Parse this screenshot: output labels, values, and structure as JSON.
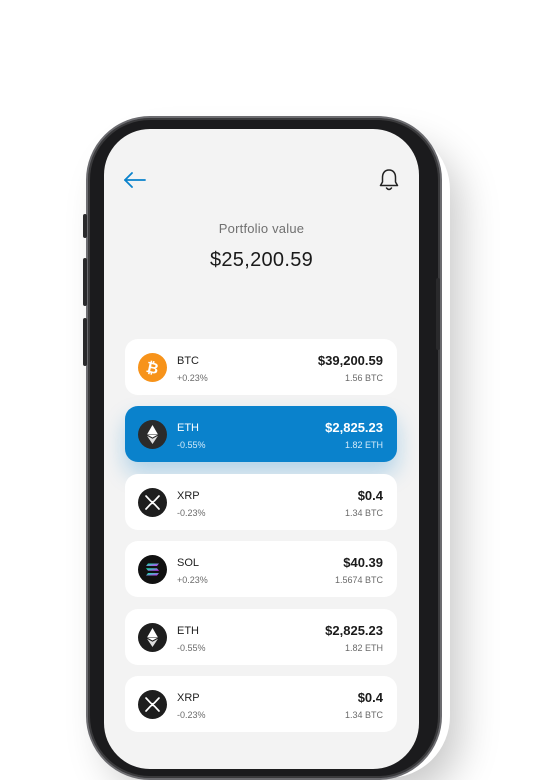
{
  "header": {
    "back_icon": "arrow-left-icon",
    "notification_icon": "bell-icon"
  },
  "portfolio": {
    "label": "Portfolio value",
    "value": "$25,200.59"
  },
  "colors": {
    "accent": "#0a82cc",
    "btc": "#f7931a",
    "dark_coin": "#1e1e1e"
  },
  "assets": [
    {
      "symbol": "BTC",
      "change": "+0.23%",
      "value": "$39,200.59",
      "amount": "1.56 BTC",
      "icon": "bitcoin-icon",
      "active": false
    },
    {
      "symbol": "ETH",
      "change": "-0.55%",
      "value": "$2,825.23",
      "amount": "1.82 ETH",
      "icon": "ethereum-icon",
      "active": true
    },
    {
      "symbol": "XRP",
      "change": "-0.23%",
      "value": "$0.4",
      "amount": "1.34 BTC",
      "icon": "xrp-icon",
      "active": false
    },
    {
      "symbol": "SOL",
      "change": "+0.23%",
      "value": "$40.39",
      "amount": "1.5674 BTC",
      "icon": "solana-icon",
      "active": false
    },
    {
      "symbol": "ETH",
      "change": "-0.55%",
      "value": "$2,825.23",
      "amount": "1.82 ETH",
      "icon": "ethereum-icon",
      "active": false
    },
    {
      "symbol": "XRP",
      "change": "-0.23%",
      "value": "$0.4",
      "amount": "1.34 BTC",
      "icon": "xrp-icon",
      "active": false
    }
  ]
}
